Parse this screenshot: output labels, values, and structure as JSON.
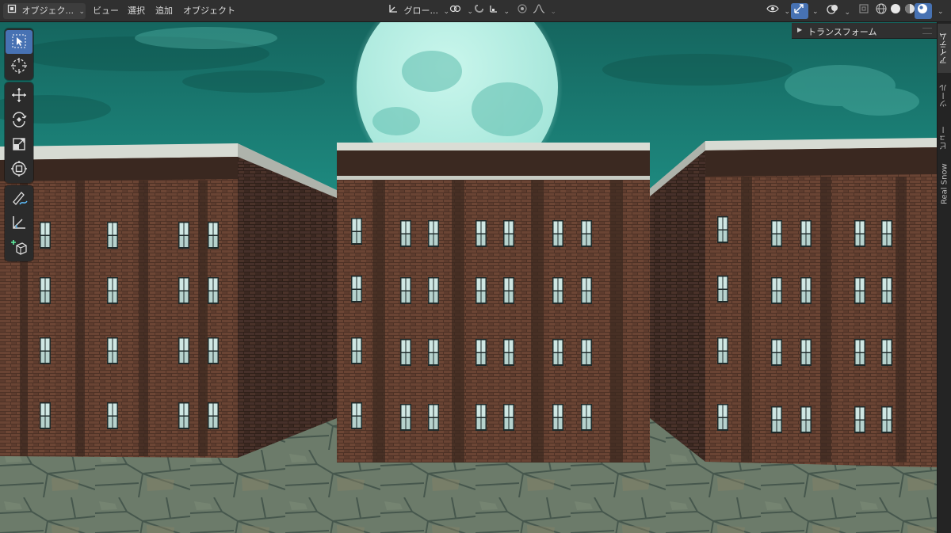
{
  "header": {
    "mode_label": "オブジェク...",
    "menus": [
      "ビュー",
      "選択",
      "追加",
      "オブジェクト"
    ],
    "transform_orientation": "グロー...",
    "shading_modes": [
      "wireframe",
      "solid",
      "material-preview",
      "rendered"
    ],
    "active_shading": "rendered"
  },
  "toolbar": {
    "tools": [
      {
        "name": "select-box-tool",
        "icon": "select-cursor-icon",
        "active": true
      },
      {
        "name": "cursor-tool",
        "icon": "3d-cursor-icon",
        "active": false
      },
      {
        "name": "move-tool",
        "icon": "move-arrows-icon",
        "active": false
      },
      {
        "name": "rotate-tool",
        "icon": "rotate-icon",
        "active": false
      },
      {
        "name": "scale-tool",
        "icon": "scale-icon",
        "active": false
      },
      {
        "name": "transform-tool",
        "icon": "transform-icon",
        "active": false
      },
      {
        "name": "annotate-tool",
        "icon": "annotate-pen-icon",
        "active": false
      },
      {
        "name": "measure-tool",
        "icon": "measure-ruler-icon",
        "active": false
      },
      {
        "name": "add-cube-tool",
        "icon": "add-cube-icon",
        "active": false
      }
    ]
  },
  "sidebar": {
    "panel_title": "トランスフォーム",
    "tabs": [
      {
        "label": "アイテム",
        "active": true
      },
      {
        "label": "ツール",
        "active": false
      },
      {
        "label": "ビュー",
        "active": false
      },
      {
        "label": "Real Snow",
        "active": false
      }
    ]
  },
  "colors": {
    "accent": "#4772b3",
    "sky": "#1f8a80",
    "moon": "#b9efe6",
    "brick": "#5a3a2c",
    "pavement": "#7a8a7c"
  }
}
